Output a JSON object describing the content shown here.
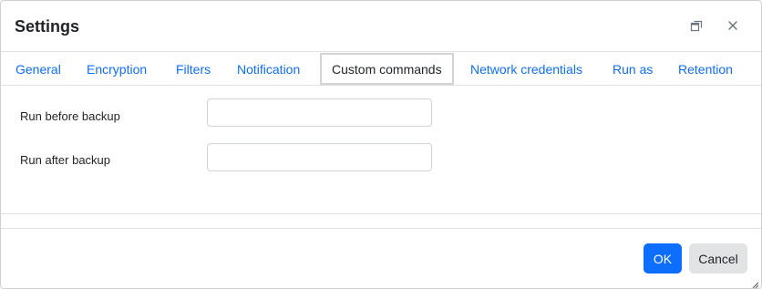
{
  "dialog": {
    "title": "Settings",
    "restore_icon": "window-restore-icon",
    "close_icon": "close-icon"
  },
  "tabs": [
    {
      "label": "General",
      "active": false
    },
    {
      "label": "Encryption",
      "active": false
    },
    {
      "label": "Filters",
      "active": false
    },
    {
      "label": "Notification",
      "active": false
    },
    {
      "label": "Custom commands",
      "active": true
    },
    {
      "label": "Network credentials",
      "active": false
    },
    {
      "label": "Run as",
      "active": false
    },
    {
      "label": "Retention",
      "active": false
    }
  ],
  "form": {
    "run_before_label": "Run before backup",
    "run_before_value": "",
    "run_after_label": "Run after backup",
    "run_after_value": ""
  },
  "footer": {
    "ok_label": "OK",
    "cancel_label": "Cancel"
  },
  "colors": {
    "link": "#0d6efd",
    "primary_button": "#0d6efd",
    "secondary_button": "#e2e3e5",
    "active_tab_border": "#d3d3d3"
  }
}
